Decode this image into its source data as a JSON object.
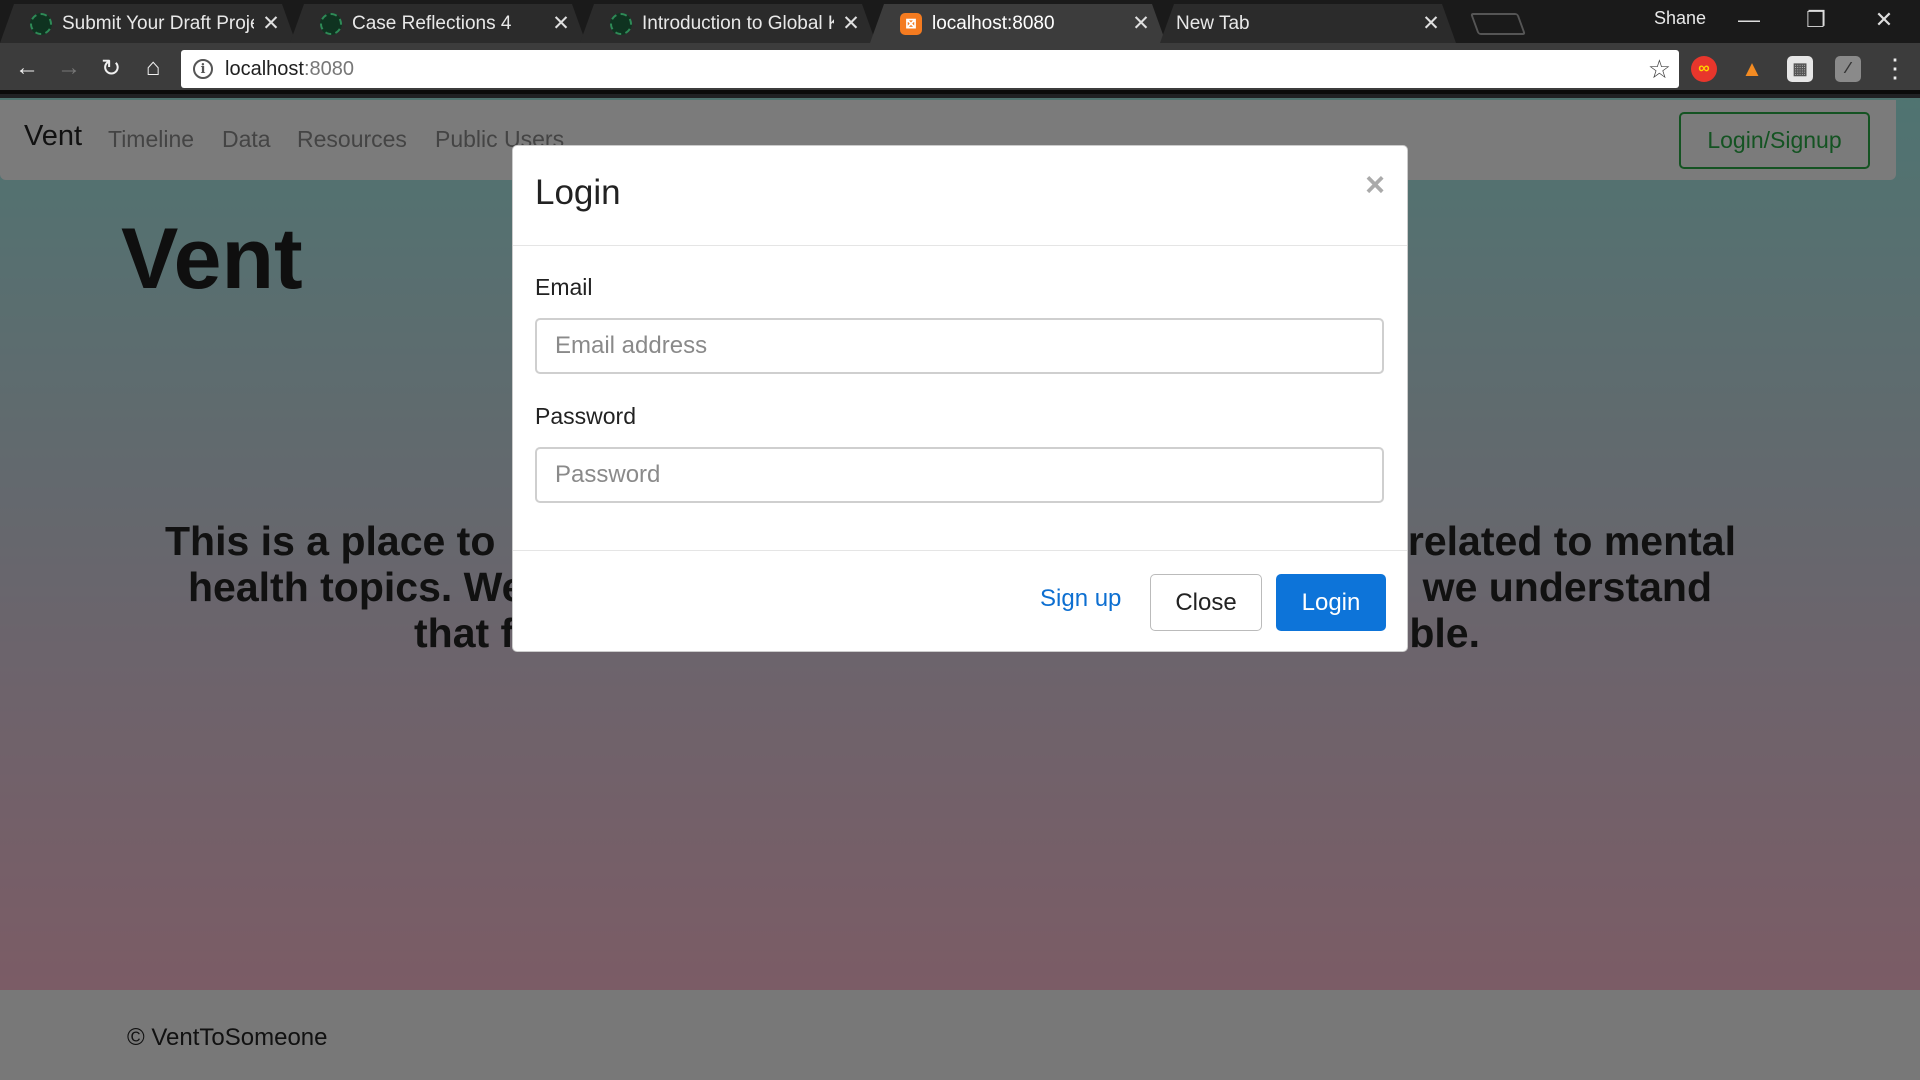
{
  "browser": {
    "tabs": [
      {
        "title": "Submit Your Draft Project",
        "favicon": "globe-icon"
      },
      {
        "title": "Case Reflections 4",
        "favicon": "globe-icon"
      },
      {
        "title": "Introduction to Global Kn",
        "favicon": "globe-icon"
      },
      {
        "title": "localhost:8080",
        "favicon": "xampp-icon"
      },
      {
        "title": "New Tab",
        "favicon": ""
      }
    ],
    "profile_name": "Shane",
    "url_host": "localhost",
    "url_port": ":8080",
    "extensions": [
      "infinity-extension-icon",
      "fox-extension-icon",
      "gift-extension-icon",
      "pdf-extension-icon"
    ]
  },
  "site": {
    "brand": "Vent",
    "nav_links": [
      "Timeline",
      "Data",
      "Resources",
      "Public Users"
    ],
    "login_signup": "Login/Signup",
    "jumbotron_title": "Vent",
    "lead_visible": [
      "This is a place to",
      "related to mental",
      "health topics. We",
      "we understand",
      "that f",
      "ble."
    ],
    "footer": "© VentToSomeone"
  },
  "modal": {
    "title": "Login",
    "close_symbol": "×",
    "email_label": "Email",
    "email_placeholder": "Email address",
    "password_label": "Password",
    "password_placeholder": "Password",
    "signup_link": "Sign up",
    "close_button": "Close",
    "login_button": "Login"
  },
  "colors": {
    "success": "#28a745",
    "primary": "#0d74d9",
    "link": "#0d6fd1"
  }
}
